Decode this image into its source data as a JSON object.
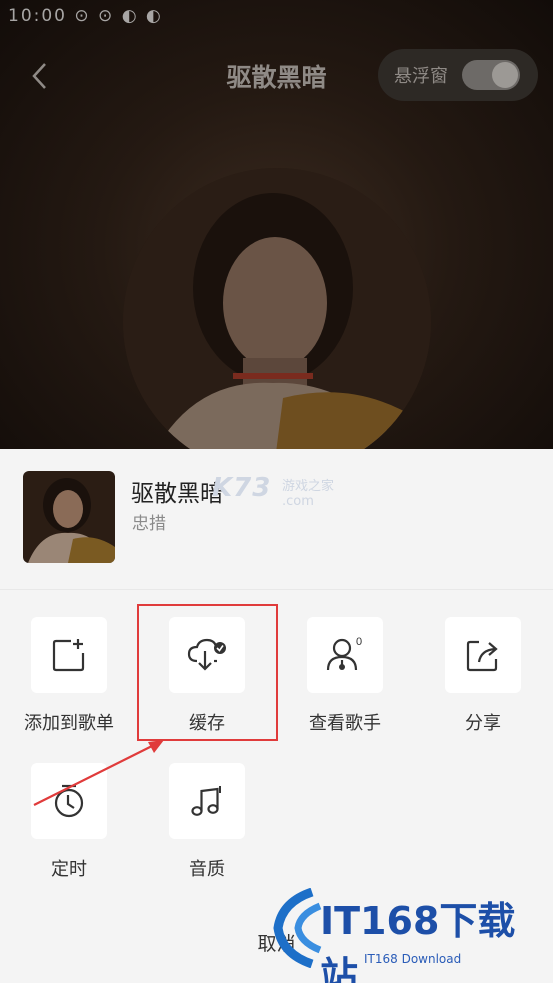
{
  "status_bar": {
    "text": "10:00 ⊙ ⊙ ◐ ◐"
  },
  "header": {
    "title": "驱散黑暗",
    "float_window_label": "悬浮窗",
    "float_window_on": true
  },
  "song": {
    "name": "驱散黑暗",
    "artist": "忠措"
  },
  "actions": [
    {
      "label": "添加到歌单",
      "icon": "add-to-playlist-icon"
    },
    {
      "label": "缓存",
      "icon": "cloud-download-icon"
    },
    {
      "label": "查看歌手",
      "icon": "singer-icon",
      "badge": "0"
    },
    {
      "label": "分享",
      "icon": "share-icon"
    },
    {
      "label": "定时",
      "icon": "timer-icon"
    },
    {
      "label": "音质",
      "icon": "music-note-icon"
    }
  ],
  "cancel_label": "取消",
  "watermarks": {
    "k73": "K73",
    "k73_sub": "游戏之家\n.com",
    "it168": "IT168下载站",
    "it168_sub": "IT168 Download"
  },
  "colors": {
    "highlight": "#e03b3b",
    "sheet_bg": "#f4f4f4"
  }
}
